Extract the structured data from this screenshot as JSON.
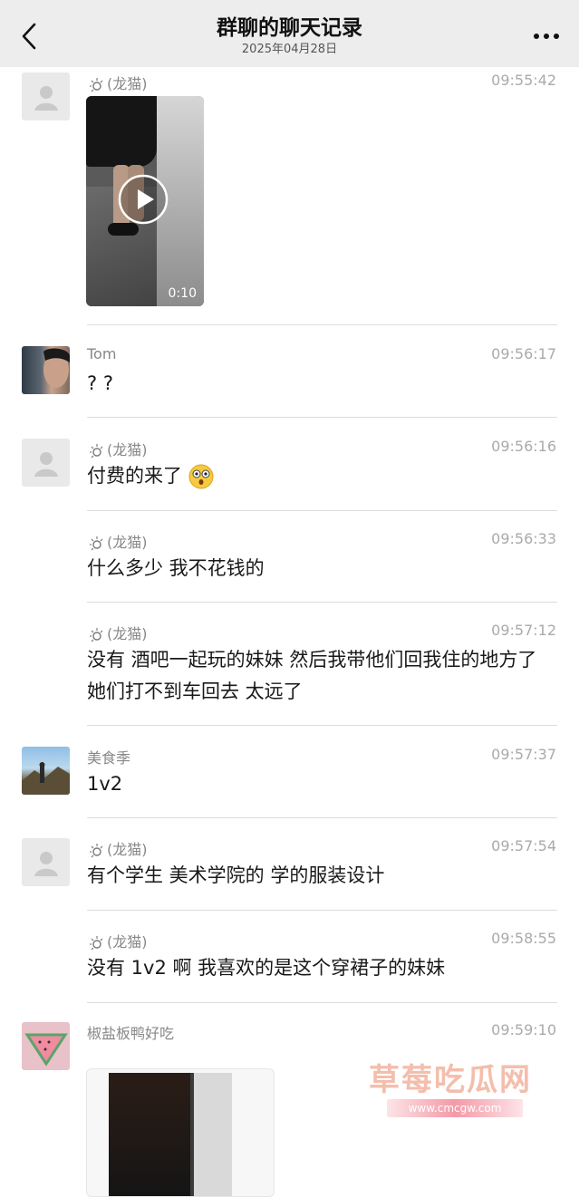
{
  "header": {
    "title": "群聊的聊天记录",
    "date": "2025年04月28日"
  },
  "messages": [
    {
      "name": "(龙猫)",
      "time": "09:55:42",
      "video_duration": "0:10"
    },
    {
      "name": "Tom",
      "time": "09:56:17",
      "text": "? ?"
    },
    {
      "name": "(龙猫)",
      "time": "09:56:16",
      "text": "付费的来了"
    },
    {
      "name": "(龙猫)",
      "time": "09:56:33",
      "text": "什么多少 我不花钱的"
    },
    {
      "name": "(龙猫)",
      "time": "09:57:12",
      "text": "没有 酒吧一起玩的妹妹 然后我带他们回我住的地方了 她们打不到车回去  太远了"
    },
    {
      "name": "美食季",
      "time": "09:57:37",
      "text": "1v2"
    },
    {
      "name": "(龙猫)",
      "time": "09:57:54",
      "text": "有个学生 美术学院的 学的服装设计"
    },
    {
      "name": "(龙猫)",
      "time": "09:58:55",
      "text": "没有 1v2 啊 我喜欢的是这个穿裙子的妹妹"
    },
    {
      "name": "椒盐板鸭好吃",
      "time": "09:59:10"
    }
  ],
  "watermark": {
    "title": "草莓吃瓜网",
    "url": "www.cmcgw.com"
  },
  "icons": {
    "back": "chevron-left-icon",
    "more": "more-dots-icon",
    "play": "play-icon",
    "emoji": "surprised-emoji-icon"
  }
}
